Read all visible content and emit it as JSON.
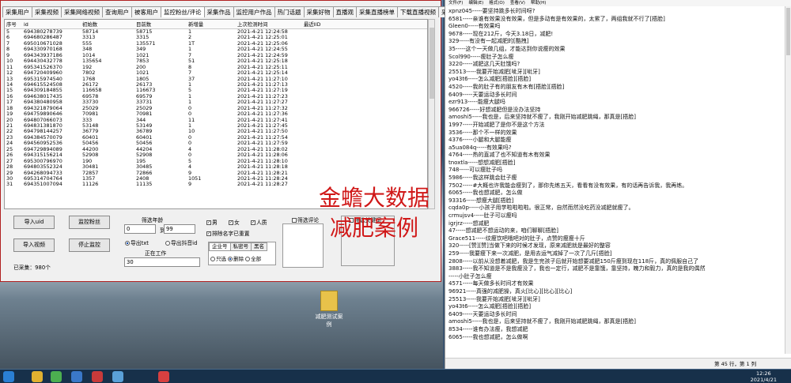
{
  "app": {
    "tabs": [
      "采集用户",
      "采集视频",
      "采集网络视频",
      "查询用户",
      "被客用户",
      "监控粉丝/评论",
      "采集作品",
      "监控用户作品",
      "热门话题",
      "采集好物",
      "直播观",
      "采集直播榜单",
      "下载直播视频",
      "采集直播间弹幕",
      "辅助功能"
    ],
    "active_tab": 5,
    "columns": [
      "序号",
      "id",
      "初始数",
      "目前数",
      "新增量",
      "上次检测时间",
      "最近IID"
    ],
    "rows": [
      [
        "5",
        "694380278739",
        "58714",
        "58715",
        "1",
        "2021-4-21 12:24:58",
        ""
      ],
      [
        "6",
        "694680286487",
        "3313",
        "3315",
        "2",
        "2021-4-21 12:25:01",
        ""
      ],
      [
        "7",
        "695010671028",
        "555",
        "135571",
        "1T",
        "2021-4-21 12:25:06",
        ""
      ],
      [
        "8",
        "694330970168",
        "348",
        "349",
        "1",
        "2021-4-21 12:24:55",
        ""
      ],
      [
        "9",
        "694343937186",
        "1014",
        "1021",
        "7",
        "2021-4-21 12:24:59",
        ""
      ],
      [
        "10",
        "694430432778",
        "135654",
        "7853",
        "51",
        "2021-4-21 12:25:18",
        ""
      ],
      [
        "11",
        "695341526370",
        "192",
        "200",
        "8",
        "2021-4-21 12:25:11",
        ""
      ],
      [
        "12",
        "694720409960",
        "7802",
        "1021",
        "7",
        "2021-4-21 12:25:14",
        ""
      ],
      [
        "13",
        "695315974540",
        "1768",
        "1805",
        "37",
        "2021-4-21 11:27:10",
        ""
      ],
      [
        "14",
        "694615524508",
        "26172",
        "26173",
        "1",
        "2021-4-21 11:27:13",
        ""
      ],
      [
        "15",
        "694309184855",
        "116658",
        "116673",
        "5",
        "2021-4-21 11:27:19",
        ""
      ],
      [
        "16",
        "694638017435",
        "69578",
        "69579",
        "1",
        "2021-4-21 11:27:23",
        ""
      ],
      [
        "17",
        "694380480958",
        "33730",
        "33731",
        "1",
        "2021-4-21 11:27:27",
        ""
      ],
      [
        "18",
        "694321879064",
        "25029",
        "25029",
        "0",
        "2021-4-21 11:27:32",
        ""
      ],
      [
        "19",
        "694759890646",
        "70981",
        "70981",
        "0",
        "2021-4-21 11:27:36",
        ""
      ],
      [
        "20",
        "694807066073",
        "333",
        "344",
        "11",
        "2021-4-21 11:27:41",
        ""
      ],
      [
        "21",
        "694831381870",
        "53148",
        "53149",
        "1",
        "2021-4-21 11:27:45",
        ""
      ],
      [
        "22",
        "694798144257",
        "36779",
        "36789",
        "10",
        "2021-4-21 11:27:50",
        ""
      ],
      [
        "23",
        "694384570079",
        "60401",
        "60401",
        "0",
        "2021-4-21 11:27:54",
        ""
      ],
      [
        "24",
        "694560952536",
        "50456",
        "50456",
        "0",
        "2021-4-21 11:27:59",
        ""
      ],
      [
        "25",
        "694729894089",
        "44200",
        "44204",
        "4",
        "2021-4-21 11:28:02",
        ""
      ],
      [
        "26",
        "694315156214",
        "52908",
        "52908",
        "0",
        "2021-4-21 11:28:06",
        ""
      ],
      [
        "27",
        "695300796970",
        "190",
        "195",
        "5",
        "2021-4-21 11:28:10",
        ""
      ],
      [
        "28",
        "694803552324",
        "30481",
        "30485",
        "4",
        "2021-4-21 11:28:18",
        ""
      ],
      [
        "29",
        "694268094733",
        "72857",
        "72866",
        "9",
        "2021-4-21 11:28:21",
        ""
      ],
      [
        "30",
        "695314704764",
        "1357",
        "2408",
        "1051",
        "2021-4-21 11:28:24",
        ""
      ],
      [
        "31",
        "694351007094",
        "11126",
        "11135",
        "9",
        "2021-4-21 11:28:27",
        ""
      ]
    ],
    "buttons": {
      "import_id": "导入uid",
      "monitor_fans": "监控粉丝",
      "import_video": "导入视频",
      "stop_monitor": "停止监控"
    },
    "filter_fans_label": "筛选年龄",
    "age_from": "0",
    "age_to_label": "到",
    "age_to": "99",
    "export_txt": "导出txt",
    "export_id": "导出抖音id",
    "working_label": "正在工作",
    "working_value": "30",
    "collected_count": "已采集：980个",
    "gender_male": "男",
    "gender_female": "女",
    "gender_person": "人质",
    "exclude_dup": "排除名字已重置",
    "enterprise_tabs": [
      "企业号",
      "私密号",
      "黑名"
    ],
    "radio_only": "只选",
    "radio_delete": "删除",
    "radio_all": "全部",
    "filter_comment": "筛选评论",
    "filter_keyword": "筛选关键词"
  },
  "overlay": {
    "line1": "金蟾大数据",
    "line2": "减肥案例"
  },
  "desktop": {
    "folder_label": "减肥测试案例"
  },
  "notepad": {
    "menu": [
      "文件(F)",
      "编辑(E)",
      "格式(O)",
      "查看(V)",
      "帮助(H)"
    ],
    "lines": [
      "xpnz045-----要坚持跳多长时间呀?",
      "6581-----亲谁有效果没有效果，但是多动有是有效果的，太累了，两组我就不行了[捂脸]",
      "Gleen0-----有效果吗",
      "9678-----现在212斤，今天3.18日，减肥!",
      "329-----有没有一起减肥的[酷拽]",
      "35-----这个一天做几组，才能达到你说瘦的效果",
      "Scol990-----瘦肚子怎么瘦",
      "3220-----减肥这几天肚饿吗?",
      "25513-----我要开始减肥[呲牙][呲牙]",
      "yo43t6-----怎么减肥[捂脸][捂脸]",
      "4520-----我的肚子有的朋友有木有[捂脸][捂脸]",
      "6409-----天要运动多长时间",
      "ezr913-----能瘦大腿吗",
      "966726-----好想减肥但是没办法坚持",
      "amoshi5-----我也是，后来坚持就不瘦了，我刚开始减肥跳绳，那真是[捂脸]",
      "1997-----开始减肥了是你不是这个方法",
      "3536-----那个不一样的效果",
      "4376-----小腿和大腿能瘦",
      "a5ua084q-----有效果吗?",
      "4764-----热的直减了也不知道有木有效果",
      "tnoxtla-----想想减肥[捂脸]",
      "748-----可以瘦肚子吗",
      "5986-----我这样跳会肚子瘦",
      "7502-----#大概也许我能会瘦到了，那你先练五天，看看有没有效果，有的话再告诉我，我再练。",
      "6065-----我也想减肥，怎么做",
      "93316-----想瘦大腿[捂脸]",
      "cqda0p-----小孩子用学啦啦啦啦。很正常，自然而然没吃药没减肥就瘦了。",
      "crmujsv4-----肚子可以瘦吗",
      "igrjrz-----想减肥",
      "47-----想减肥不想运动的来，咱们聊聊[捂脸]",
      "Grace511-----纹瘦饮吧哦吧对的肚子，点赞的瘦瘦十斤",
      "320-----[赞][赞]当做下来的时候才发现，原来减肥就是最好的整容",
      "259-----我要瘦下来一次减肥，是用去运气减掉了一次了几斤[捂脸]",
      "2808-----以前从没想着减肥，我是生完孩子后就开始想要减肥150斤瘦到现在118斤，真的佩服自己了",
      "3883-----我不知道是不是我瘦没了，我也一定行，减肥不是靠饿，靠坚持，魄力和毅力，真的是我的偶然",
      "-----小肚子怎么瘦",
      "4571-----每天做多长时间才有效果",
      "96921-----真强的减肥操，真火[比心][比心][比心]",
      "25513-----我要开始减肥[呲牙][呲牙]",
      "yo43t6-----怎么减肥[捂脸][捂脸]",
      "6409-----天要运动多长时间",
      "amoshi5-----我也是，后来坚持就不瘦了，我刚开始减肥跳绳，那真是[捂脸]",
      "8534-----谁有办法瘦，我想减肥",
      "6065-----我也想减肥，怎么做啊"
    ],
    "status": "第 45 行，第 1 列"
  },
  "taskbar": {
    "time": "12:26",
    "date": "2021/4/21"
  }
}
